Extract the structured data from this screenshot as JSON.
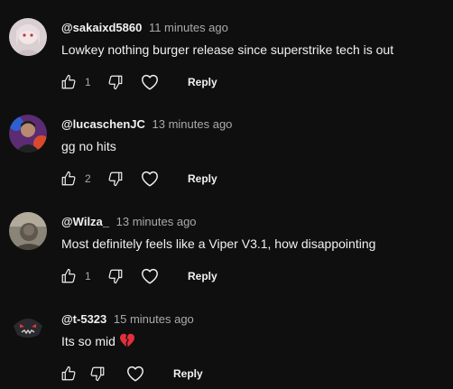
{
  "colors": {
    "background": "#0f0f0f",
    "text_primary": "#f1f1f1",
    "text_secondary": "#aaaaaa",
    "broken_heart": "#e0303b"
  },
  "comments": [
    {
      "author": "@sakaixd5860",
      "time": "11 minutes ago",
      "text": "Lowkey nothing burger release since superstrike tech is out",
      "likes": "1",
      "reply_label": "Reply",
      "avatar_icon": "anime-avatar"
    },
    {
      "author": "@lucaschenJC",
      "time": "13 minutes ago",
      "text": "gg no hits",
      "likes": "2",
      "reply_label": "Reply",
      "avatar_icon": "person-avatar"
    },
    {
      "author": "@Wilza_",
      "time": "13 minutes ago",
      "text": "Most definitely feels like a Viper V3.1, how disappointing",
      "likes": "1",
      "reply_label": "Reply",
      "avatar_icon": "photo-avatar"
    },
    {
      "author": "@t-5323",
      "time": "15 minutes ago",
      "text": "Its so mid",
      "likes": "",
      "reply_label": "Reply",
      "avatar_icon": "masked-character-avatar",
      "emoji": "broken-heart-icon"
    }
  ]
}
